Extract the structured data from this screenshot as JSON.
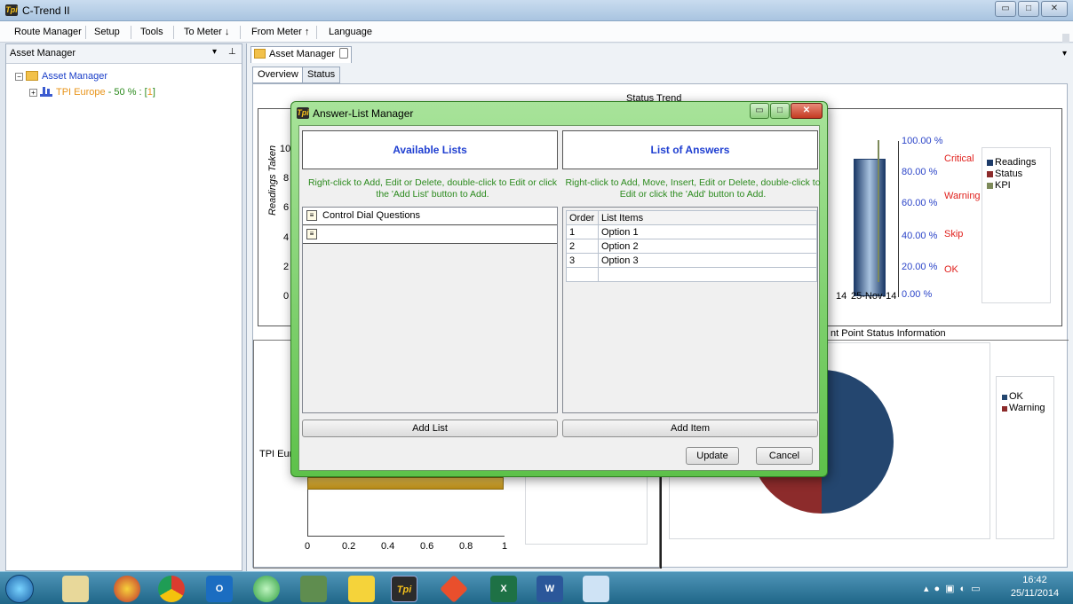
{
  "app": {
    "title": "C-Trend II"
  },
  "menu": [
    "Route Manager",
    "Setup",
    "Tools",
    "To Meter ↓",
    "From Meter ↑",
    "Language"
  ],
  "left_panel": {
    "title": "Asset Manager",
    "tree": {
      "root": "Asset Manager",
      "child_name": "TPI Europe",
      "child_pct": " - 50 % : [",
      "child_count": "1",
      "child_end": "]"
    }
  },
  "doc": {
    "tab_title": "Asset Manager",
    "tabs": [
      "Overview",
      "Status"
    ],
    "status_trend_title": "Status Trend",
    "y_axis_label": "Readings Taken",
    "y_ticks": [
      "10",
      "8",
      "6",
      "4",
      "2",
      "0"
    ],
    "pct_ticks": [
      "100.00 %",
      "80.00 %",
      "60.00 %",
      "40.00 %",
      "20.00 %",
      "0.00 %"
    ],
    "status_labels": [
      "Critical",
      "Warning",
      "Skip",
      "OK"
    ],
    "x_labels": [
      "14",
      "25-Nov-14"
    ],
    "legend1": [
      "Readings",
      "Status",
      "KPI"
    ],
    "pie_title_partial": "nt Point Status Information",
    "legend2": [
      "OK",
      "Warning"
    ],
    "bar_row_label": "TPI Eur",
    "bar_ticks": [
      "0",
      "0.2",
      "0.4",
      "0.6",
      "0.8",
      "1"
    ]
  },
  "dialog": {
    "title": "Answer-List Manager",
    "available_header": "Available Lists",
    "answers_header": "List of Answers",
    "available_help": "Right-click to Add, Edit or Delete, double-click to Edit or click the 'Add List' button to Add.",
    "answers_help": "Right-click to Add, Move, Insert, Edit or Delete, double-click to Edit or click the 'Add' button to Add.",
    "lists": [
      "Control Dial Questions",
      ""
    ],
    "columns": [
      "Order",
      "List Items"
    ],
    "items": [
      {
        "order": "1",
        "label": "Option 1"
      },
      {
        "order": "2",
        "label": "Option 2"
      },
      {
        "order": "3",
        "label": "Option 3"
      }
    ],
    "add_list": "Add List",
    "add_item": "Add Item",
    "update": "Update",
    "cancel": "Cancel"
  },
  "taskbar": {
    "time": "16:42",
    "date": "25/11/2014"
  },
  "colors": {
    "header_blue": "#1f3fd1",
    "green_text": "#2b8a1d",
    "status_red": "#e0201c"
  }
}
